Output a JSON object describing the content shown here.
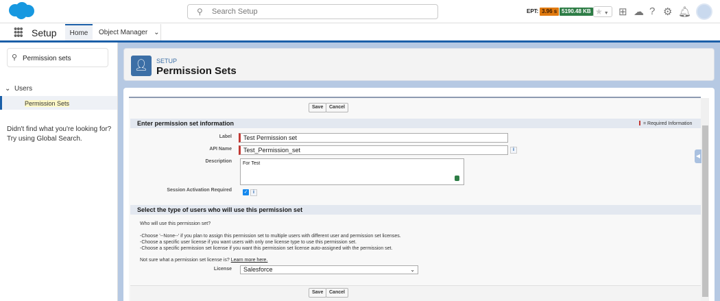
{
  "header": {
    "search_placeholder": "Search Setup",
    "ept_label": "EPT:",
    "ept_time": "3.96 s",
    "ept_size": "5190.48 KB"
  },
  "nav": {
    "app_name": "Setup",
    "tabs": [
      {
        "label": "Home"
      },
      {
        "label": "Object Manager"
      }
    ]
  },
  "sidebar": {
    "search_value": "Permission sets",
    "group": "Users",
    "item": "Permission Sets",
    "help_line1": "Didn't find what you're looking for?",
    "help_line2": "Try using Global Search."
  },
  "page": {
    "breadcrumb": "SETUP",
    "title": "Permission Sets"
  },
  "form": {
    "save": "Save",
    "cancel": "Cancel",
    "section1": "Enter permission set information",
    "required_note": "= Required Information",
    "label_label": "Label",
    "label_value": "Test Permission set",
    "api_label": "API Name",
    "api_value": "Test_Permission_set",
    "desc_label": "Description",
    "desc_value": "For Test",
    "session_label": "Session Activation Required",
    "session_checked": true,
    "section2": "Select the type of users who will use this permission set",
    "who": "Who will use this permission set?",
    "lines": [
      "-Choose '--None--' if you plan to assign this permission set to multiple users with different user and permission set licenses.",
      "-Choose a specific user license if you want users with only one license type to use this permission set.",
      "-Choose a specific permission set license if you want this permission set license auto-assigned with the permission set."
    ],
    "notsure": "Not sure what a permission set license is?",
    "learn": "Learn more here.",
    "license_label": "License",
    "license_value": "Salesforce"
  },
  "colors": {
    "brand": "#1b5fa8",
    "required": "#c23934",
    "ept_time": "#e07a10",
    "ept_size": "#2e7d46"
  }
}
